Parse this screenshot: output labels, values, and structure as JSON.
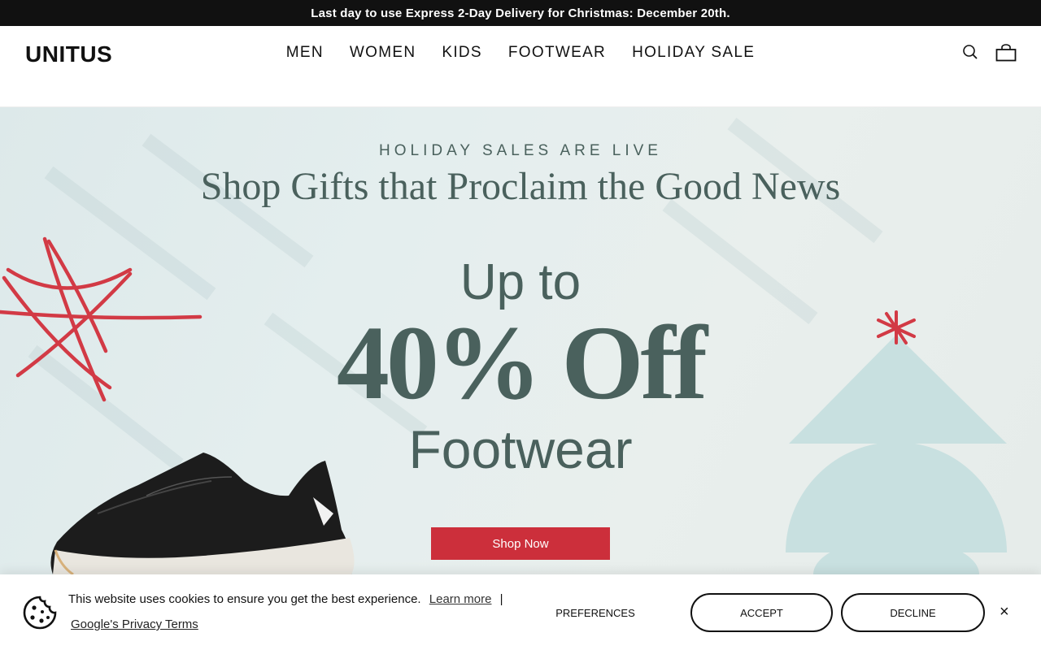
{
  "announcement": {
    "text": "Last day to use Express 2-Day Delivery for Christmas: December 20th."
  },
  "header": {
    "logo": "UNITUS",
    "nav": [
      "MEN",
      "WOMEN",
      "KIDS",
      "FOOTWEAR",
      "HOLIDAY SALE"
    ],
    "icons": [
      "search-icon",
      "cart-icon"
    ]
  },
  "hero": {
    "eyebrow": "HOLIDAY SALES ARE LIVE",
    "title": "Shop Gifts that Proclaim the Good News",
    "line1": "Up to",
    "line2": "40% Off",
    "line3": "Footwear",
    "cta": "Shop Now",
    "colors": {
      "text": "#4a615d",
      "cta": "#cc2f3b",
      "star": "#d23a45",
      "tree": "#c8e0e0"
    }
  },
  "cookie_banner": {
    "message": "This website uses cookies to ensure you get the best experience.",
    "learn_more": "Learn more",
    "separator": "|",
    "privacy_link": "Google's Privacy Terms",
    "preferences": "PREFERENCES",
    "accept": "ACCEPT",
    "decline": "DECLINE",
    "close": "×"
  }
}
